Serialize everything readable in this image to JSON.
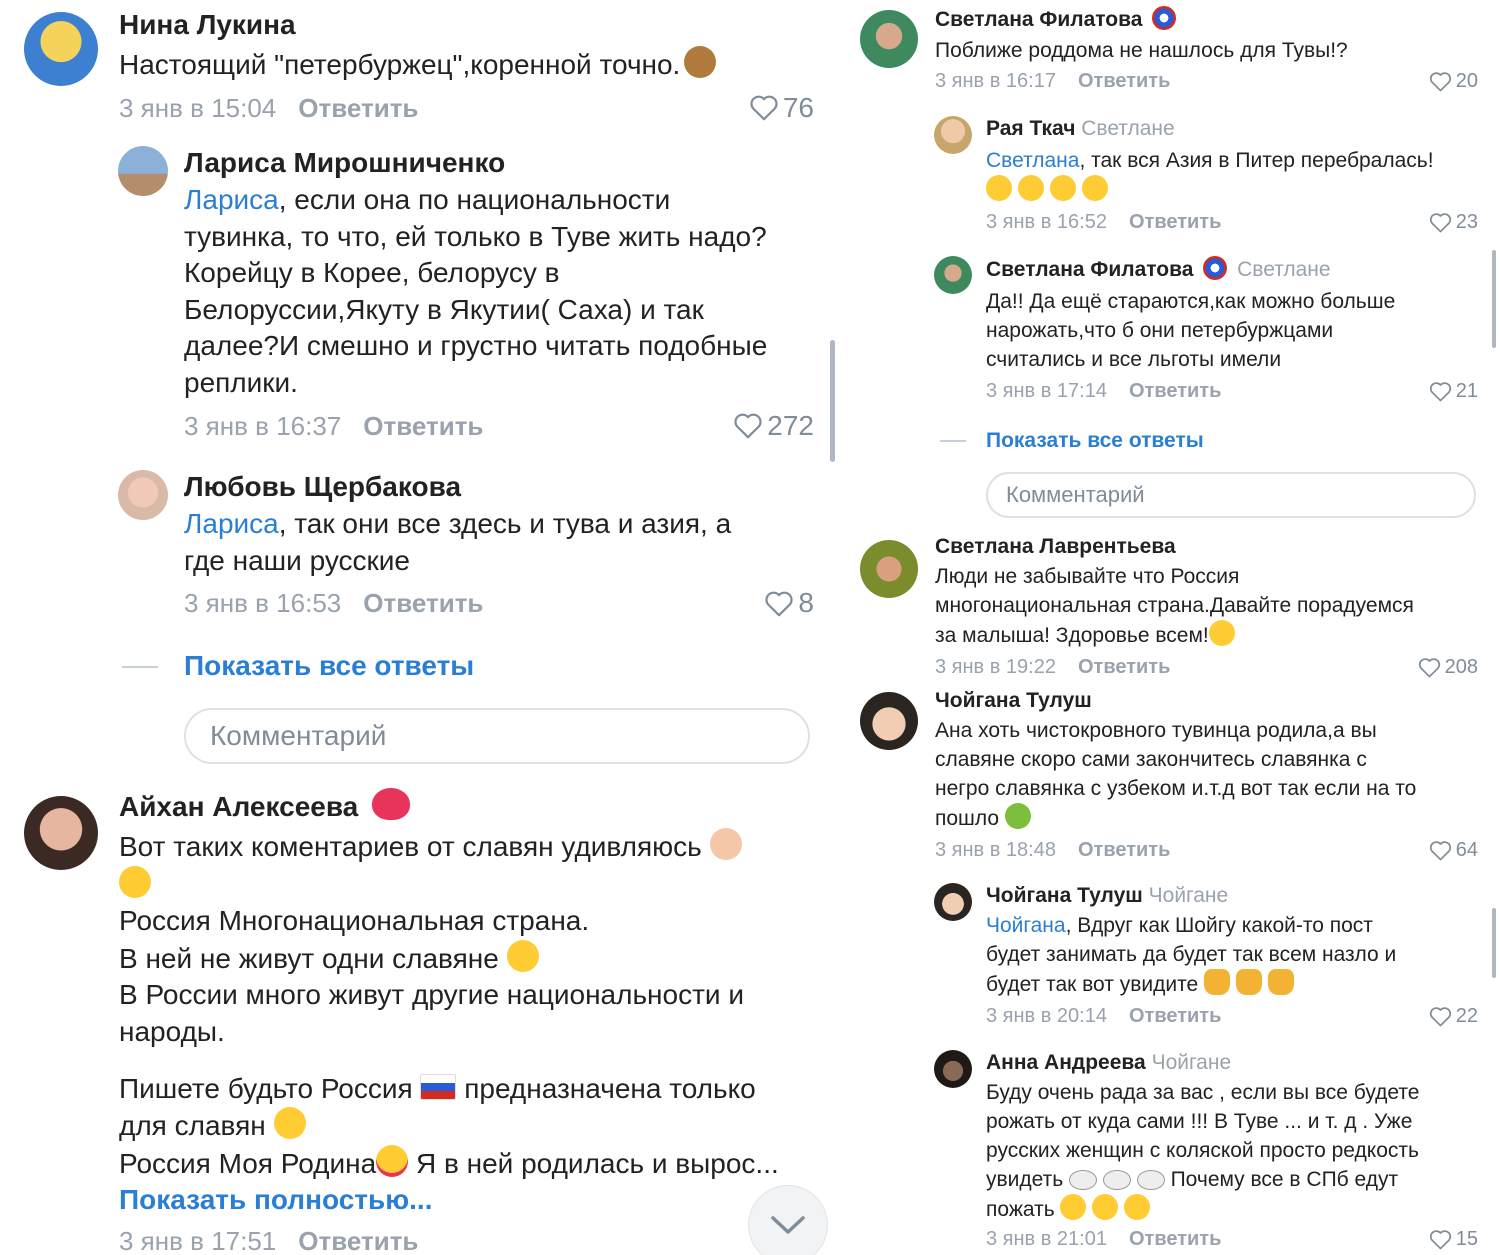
{
  "reply_label": "Ответить",
  "show_all_label": "Показать все ответы",
  "comment_placeholder": "Комментарий",
  "show_more_label": "Показать полностью...",
  "left": {
    "c1": {
      "author": "Нина Лукина",
      "text": "Настоящий \"петербуржец\",коренной точно.",
      "date": "3 янв в 15:04",
      "likes": "76"
    },
    "r1": {
      "author": "Лариса Мирошниченко",
      "mention": "Лариса",
      "text": [
        ", если она по национальности",
        "тувинка, то что, ей только в Туве жить надо?",
        "Корейцу в Корее, белорусу в",
        "Белоруссии,Якуту в Якутии( Саха) и так",
        "далее?И смешно и грустно читать подобные",
        "реплики."
      ],
      "date": "3 янв в 16:37",
      "likes": "272"
    },
    "r2": {
      "author": "Любовь Щербакова",
      "mention": "Лариса",
      "text": [
        ", так они все здесь и тува и азия, а",
        "где наши русские"
      ],
      "date": "3 янв в 16:53",
      "likes": "8"
    },
    "c2": {
      "author": "Айхан Алексеева",
      "text": [
        "Вот таких коментариев от славян удивляюсь",
        "",
        "Россия Многонациональная страна.",
        "В ней не живут одни славяне",
        "В России много живут другие национальности и",
        "народы."
      ],
      "text2": [
        "Пишете будьто Россия",
        "предназначена только",
        "для славян",
        "Россия Моя Родина",
        "Я в ней родилась и вырос..."
      ],
      "date": "3 янв в 17:51"
    }
  },
  "right": {
    "c1": {
      "author": "Светлана Филатова",
      "text": "Поближе роддома не нашлось для Тувы!?",
      "date": "3 янв в 16:17",
      "likes": "20"
    },
    "r1": {
      "author": "Рая Ткач",
      "reply_to": "Светлане",
      "mention": "Светлана",
      "text": ", так вся Азия в Питер перебралась!",
      "date": "3 янв в 16:52",
      "likes": "23"
    },
    "r2": {
      "author": "Светлана Филатова",
      "reply_to": "Светлане",
      "text": [
        "Да!! Да ещё стараются,как можно больше",
        "нарожать,что б они петербуржцами",
        "считались и все льготы имели"
      ],
      "date": "3 янв в 17:14",
      "likes": "21"
    },
    "c2": {
      "author": "Светлана Лаврентьева",
      "text": [
        "Люди не забывайте что Россия",
        "многонациональная страна.Давайте порадуемся",
        "за малыша! Здоровье всем!"
      ],
      "date": "3 янв в 19:22",
      "likes": "208"
    },
    "c3": {
      "author": "Чойгана Тулуш",
      "text": [
        "Ана хоть чистокровного тувинца родила,а вы",
        "славяне скоро сами закончитесь славянка с",
        "негро славянка с узбеком и.т.д вот так если на то",
        "пошло"
      ],
      "date": "3 янв в 18:48",
      "likes": "64"
    },
    "r3": {
      "author": "Чойгана Тулуш",
      "reply_to": "Чойгане",
      "mention": "Чойгана",
      "text": [
        ", Вдруг как Шойгу какой-то пост",
        "будет занимать да будет так всем назло и",
        "будет так вот увидите"
      ],
      "date": "3 янв в 20:14",
      "likes": "22"
    },
    "r4": {
      "author": "Анна Андреева",
      "reply_to": "Чойгане",
      "text": [
        "Буду очень рада за вас , если вы все будете",
        "рожать от куда сами !!! В Туве ... и т. д . Уже",
        "русских женщин с коляской просто редкость",
        "увидеть",
        "Почему все в СПб едут",
        "пожать"
      ],
      "date": "3 янв в 21:01",
      "likes": "15"
    }
  },
  "colors": {
    "accent": "#2a7fd4",
    "secondary": "#99a2ad",
    "text": "#222222"
  }
}
